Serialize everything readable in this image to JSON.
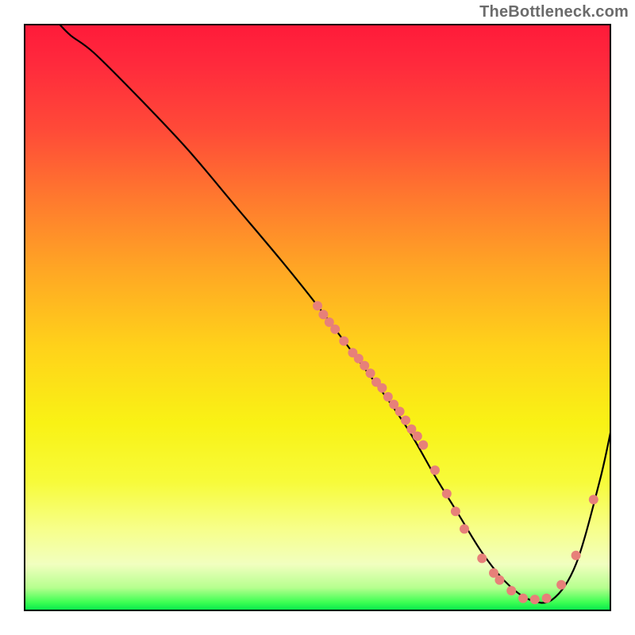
{
  "attribution": "TheBottleneck.com",
  "gradient_stops": [
    {
      "offset": 0.0,
      "color": "#ff1a3a"
    },
    {
      "offset": 0.07,
      "color": "#ff2a3c"
    },
    {
      "offset": 0.18,
      "color": "#ff4a38"
    },
    {
      "offset": 0.3,
      "color": "#ff7a2e"
    },
    {
      "offset": 0.42,
      "color": "#ffa724"
    },
    {
      "offset": 0.55,
      "color": "#ffd21a"
    },
    {
      "offset": 0.68,
      "color": "#f9f215"
    },
    {
      "offset": 0.78,
      "color": "#f7fb3a"
    },
    {
      "offset": 0.86,
      "color": "#f7ff8a"
    },
    {
      "offset": 0.92,
      "color": "#f1ffbf"
    },
    {
      "offset": 0.96,
      "color": "#b6ff8f"
    },
    {
      "offset": 0.985,
      "color": "#3cff52"
    },
    {
      "offset": 1.0,
      "color": "#00e64d"
    }
  ],
  "chart_data": {
    "type": "line",
    "title": "",
    "xlabel": "",
    "ylabel": "",
    "xlim": [
      0,
      100
    ],
    "ylim": [
      0,
      100
    ],
    "series": [
      {
        "name": "bottleneck-curve",
        "x_estimated": [
          6,
          8,
          12,
          20,
          28,
          36,
          44,
          50,
          56,
          62,
          66,
          70,
          74,
          78,
          82,
          86,
          90,
          94,
          98,
          100
        ],
        "y_estimated": [
          100,
          98,
          95,
          87,
          78.5,
          69,
          59.5,
          52,
          44,
          36,
          30,
          23,
          16.5,
          10,
          5,
          2,
          2,
          8,
          22,
          31
        ]
      }
    ],
    "highlight_points": {
      "name": "sample-dots",
      "color": "#e78079",
      "points_xy_estimated": [
        [
          50,
          52
        ],
        [
          51,
          50.5
        ],
        [
          52,
          49.2
        ],
        [
          53,
          48
        ],
        [
          54.5,
          46
        ],
        [
          56,
          44
        ],
        [
          57,
          43
        ],
        [
          58,
          41.8
        ],
        [
          59,
          40.5
        ],
        [
          60,
          39
        ],
        [
          61,
          38
        ],
        [
          62,
          36.5
        ],
        [
          63,
          35.2
        ],
        [
          64,
          34
        ],
        [
          65,
          32.5
        ],
        [
          66,
          31
        ],
        [
          67,
          29.8
        ],
        [
          68,
          28.3
        ],
        [
          70,
          24
        ],
        [
          72,
          20
        ],
        [
          73.5,
          17
        ],
        [
          75,
          14
        ],
        [
          78,
          9
        ],
        [
          80,
          6.5
        ],
        [
          81,
          5.3
        ],
        [
          83,
          3.5
        ],
        [
          85,
          2.2
        ],
        [
          87,
          2
        ],
        [
          89,
          2.2
        ],
        [
          91.5,
          4.5
        ],
        [
          94,
          9.5
        ],
        [
          97,
          19
        ]
      ]
    },
    "notes": "No axis tick labels or title rendered in source image. Values are proportional estimates (0–100) read from geometry; source image shows a deep V-shaped bottleneck curve over a vertical red→green gradient with salmon scatter dots along the curve roughly between x≈50 and x≈97."
  }
}
